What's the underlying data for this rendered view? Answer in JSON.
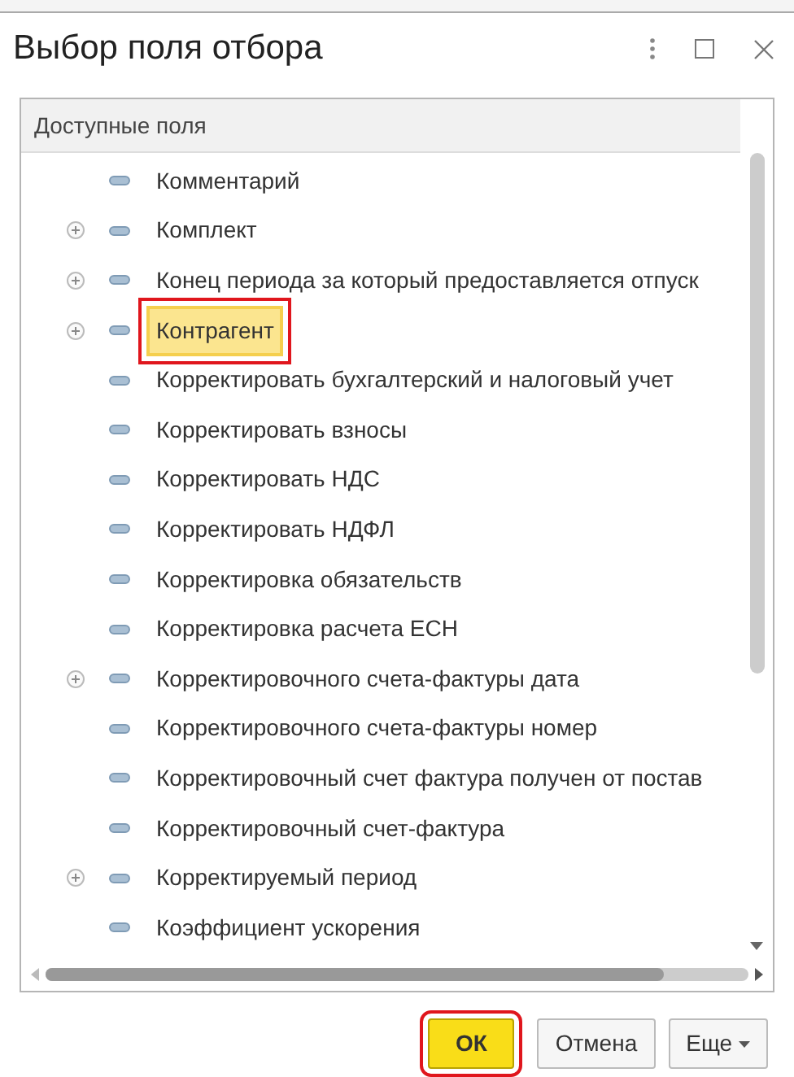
{
  "window": {
    "title": "Выбор поля отбора"
  },
  "tree": {
    "header": "Доступные поля",
    "items": [
      {
        "label": "Комментарий",
        "expandable": false,
        "selected": false,
        "annotated": false
      },
      {
        "label": "Комплект",
        "expandable": true,
        "selected": false,
        "annotated": false
      },
      {
        "label": "Конец периода за который предоставляется отпуск",
        "expandable": true,
        "selected": false,
        "annotated": false
      },
      {
        "label": "Контрагент",
        "expandable": true,
        "selected": true,
        "annotated": true
      },
      {
        "label": "Корректировать бухгалтерский и налоговый учет",
        "expandable": false,
        "selected": false,
        "annotated": false
      },
      {
        "label": "Корректировать взносы",
        "expandable": false,
        "selected": false,
        "annotated": false
      },
      {
        "label": "Корректировать НДС",
        "expandable": false,
        "selected": false,
        "annotated": false
      },
      {
        "label": "Корректировать НДФЛ",
        "expandable": false,
        "selected": false,
        "annotated": false
      },
      {
        "label": "Корректировка обязательств",
        "expandable": false,
        "selected": false,
        "annotated": false
      },
      {
        "label": "Корректировка расчета ЕСН",
        "expandable": false,
        "selected": false,
        "annotated": false
      },
      {
        "label": "Корректировочного счета-фактуры дата",
        "expandable": true,
        "selected": false,
        "annotated": false
      },
      {
        "label": "Корректировочного счета-фактуры номер",
        "expandable": false,
        "selected": false,
        "annotated": false
      },
      {
        "label": "Корректировочный счет фактура получен от постав",
        "expandable": false,
        "selected": false,
        "annotated": false
      },
      {
        "label": "Корректировочный счет-фактура",
        "expandable": false,
        "selected": false,
        "annotated": false
      },
      {
        "label": "Корректируемый период",
        "expandable": true,
        "selected": false,
        "annotated": false
      },
      {
        "label": "Коэффициент ускорения",
        "expandable": false,
        "selected": false,
        "annotated": false
      }
    ]
  },
  "buttons": [
    {
      "label": "ОК",
      "kind": "primary",
      "annotated": true
    },
    {
      "label": "Отмена",
      "kind": "plain",
      "annotated": false
    },
    {
      "label": "Еще",
      "kind": "menu",
      "annotated": false
    }
  ]
}
